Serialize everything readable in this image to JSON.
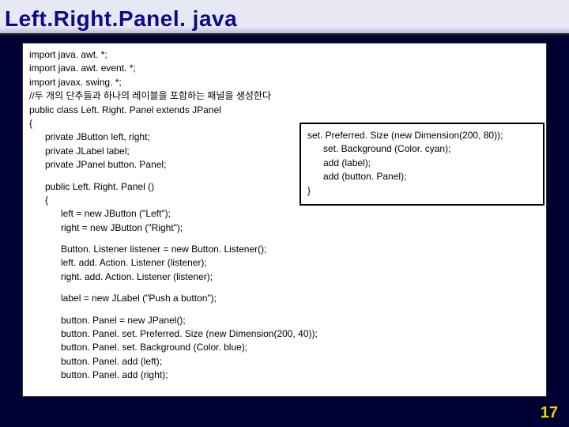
{
  "title": "Left.Right.Panel. java",
  "code": {
    "l01": "import java. awt. *;",
    "l02": "import java. awt. event. *;",
    "l03": "import javax. swing. *;",
    "l04": "//두 개의 단추들과 하나의 레이블을 포함하는 패널을 생성한다",
    "l05": "public class Left. Right. Panel extends JPanel",
    "l06": "{",
    "l07": "private JButton left, right;",
    "l08": "private JLabel label;",
    "l09": "private JPanel button. Panel;",
    "l10": "public Left. Right. Panel ()",
    "l11": "{",
    "l12": "left = new JButton (\"Left\");",
    "l13": "right = new JButton (\"Right\");",
    "l14": "Button. Listener listener = new Button. Listener();",
    "l15": "left. add. Action. Listener (listener);",
    "l16": "right. add. Action. Listener (listener);",
    "l17": "label = new JLabel (\"Push a button\");",
    "l18": "button. Panel = new JPanel();",
    "l19": "button. Panel. set. Preferred. Size (new Dimension(200, 40));",
    "l20": "button. Panel. set. Background (Color. blue);",
    "l21": "button. Panel. add (left);",
    "l22": "button. Panel. add (right);"
  },
  "overlay": {
    "o1": "set. Preferred. Size (new Dimension(200, 80));",
    "o2": "set. Background (Color. cyan);",
    "o3": "add (label);",
    "o4": "add (button. Panel);",
    "o5": "}"
  },
  "page_number": "17"
}
